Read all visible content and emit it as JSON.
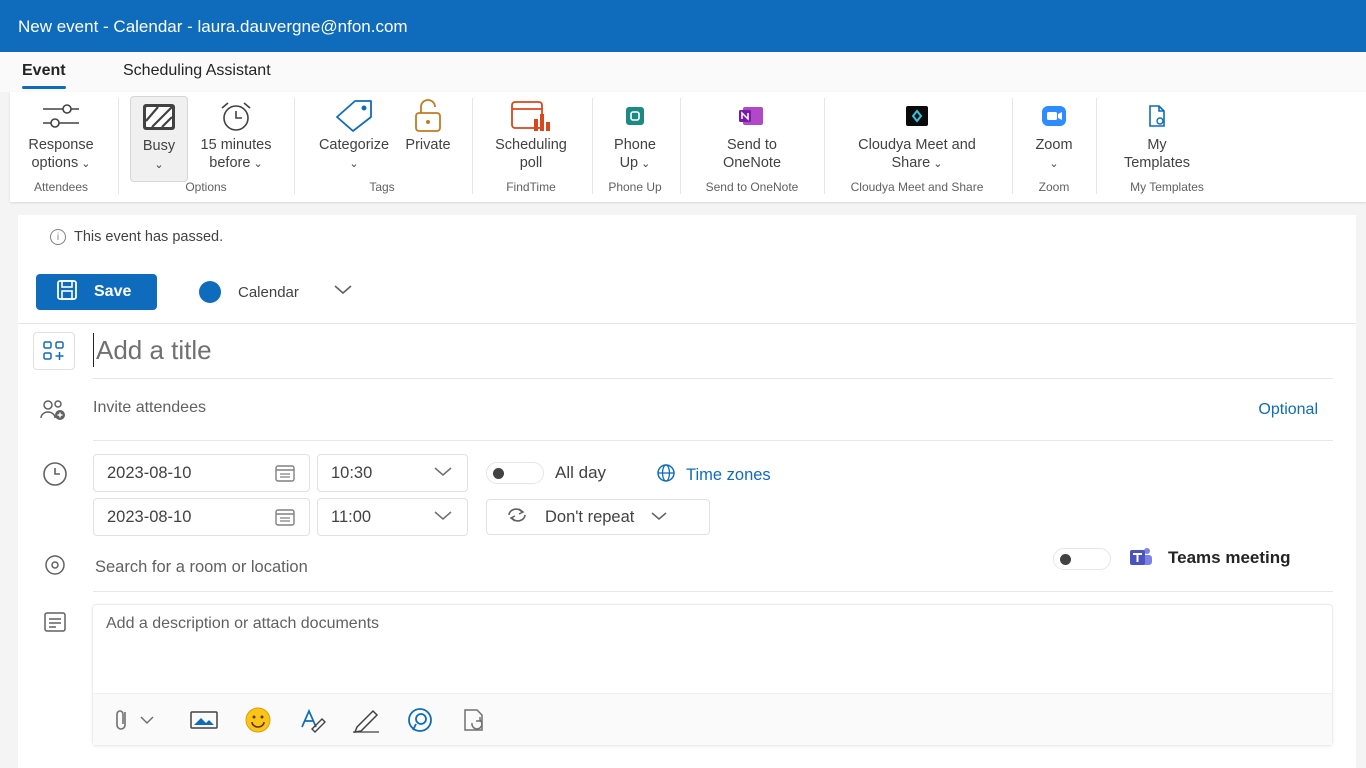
{
  "window": {
    "title": "New event - Calendar - laura.dauvergne@nfon.com"
  },
  "tabs": [
    {
      "label": "Event",
      "active": true
    },
    {
      "label": "Scheduling Assistant",
      "active": false
    }
  ],
  "ribbon": {
    "groups": [
      {
        "name": "Attendees",
        "buttons": [
          {
            "label": "Response\noptions",
            "icon": "response-options-icon",
            "has_dropdown": true
          }
        ]
      },
      {
        "name": "Options",
        "buttons": [
          {
            "label": "Busy",
            "icon": "busy-icon",
            "has_dropdown": true,
            "selected": true
          },
          {
            "label": "15 minutes\nbefore",
            "icon": "alarm-clock-icon",
            "has_dropdown": true
          }
        ]
      },
      {
        "name": "Tags",
        "buttons": [
          {
            "label": "Categorize",
            "icon": "tag-icon",
            "has_dropdown": true
          },
          {
            "label": "Private",
            "icon": "unlocked-icon",
            "has_dropdown": false
          }
        ]
      },
      {
        "name": "FindTime",
        "buttons": [
          {
            "label": "Scheduling\npoll",
            "icon": "scheduling-poll-icon",
            "has_dropdown": false
          }
        ]
      },
      {
        "name": "Phone Up",
        "buttons": [
          {
            "label": "Phone\nUp",
            "icon": "phone-up-icon",
            "has_dropdown": true
          }
        ]
      },
      {
        "name": "Send to OneNote",
        "buttons": [
          {
            "label": "Send to\nOneNote",
            "icon": "onenote-icon",
            "has_dropdown": false
          }
        ]
      },
      {
        "name": "Cloudya Meet and Share",
        "buttons": [
          {
            "label": "Cloudya Meet and\nShare",
            "icon": "cloudya-icon",
            "has_dropdown": true
          }
        ]
      },
      {
        "name": "Zoom",
        "buttons": [
          {
            "label": "Zoom",
            "icon": "zoom-icon",
            "has_dropdown": true
          }
        ]
      },
      {
        "name": "My Templates",
        "buttons": [
          {
            "label": "My\nTemplates",
            "icon": "templates-icon",
            "has_dropdown": false
          }
        ]
      }
    ]
  },
  "notice": {
    "text": "This event has passed."
  },
  "toolbar": {
    "save_label": "Save",
    "calendar_label": "Calendar",
    "calendar_color": "#0f6cbd"
  },
  "form": {
    "title_placeholder": "Add a title",
    "attendees_placeholder": "Invite attendees",
    "optional_label": "Optional",
    "start_date": "2023-08-10",
    "start_time": "10:30",
    "end_date": "2023-08-10",
    "end_time": "11:00",
    "all_day_label": "All day",
    "all_day": false,
    "time_zones_label": "Time zones",
    "repeat_label": "Don't repeat",
    "location_placeholder": "Search for a room or location",
    "teams_meeting_label": "Teams meeting",
    "teams_meeting": false,
    "description_placeholder": "Add a description or attach documents"
  },
  "description_toolbar": {
    "icons": [
      "paperclip-icon",
      "image-icon",
      "emoji-icon",
      "format-text-icon",
      "draw-icon",
      "loop-icon",
      "signature-icon"
    ]
  },
  "colors": {
    "accent": "#0f6cbd",
    "titlebar": "#0f6cbd"
  }
}
